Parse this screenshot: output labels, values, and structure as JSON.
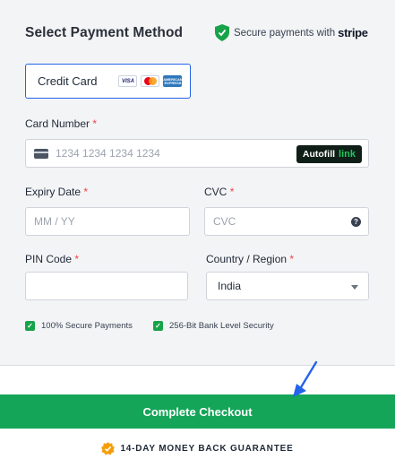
{
  "header": {
    "title": "Select Payment Method",
    "secure_text": "Secure payments with",
    "brand": "stripe"
  },
  "method": {
    "label": "Credit Card",
    "logos": [
      "VISA",
      "mastercard",
      "AMERICAN EXPRESS"
    ]
  },
  "card_number": {
    "label": "Card Number",
    "required_mark": "*",
    "placeholder": "1234 1234 1234 1234",
    "autofill_label": "Autofill",
    "autofill_link": "link"
  },
  "expiry": {
    "label": "Expiry Date",
    "required_mark": "*",
    "placeholder": "MM / YY"
  },
  "cvc": {
    "label": "CVC",
    "required_mark": "*",
    "placeholder": "CVC",
    "help_icon": "?"
  },
  "pin": {
    "label": "PIN Code",
    "required_mark": "*",
    "value": ""
  },
  "country": {
    "label": "Country / Region",
    "required_mark": "*",
    "selected": "India"
  },
  "badges": [
    {
      "label": "100% Secure Payments"
    },
    {
      "label": "256-Bit Bank Level Security"
    }
  ],
  "checkout": {
    "button_label": "Complete Checkout"
  },
  "guarantee": {
    "text": "14-DAY MONEY BACK GUARANTEE"
  },
  "colors": {
    "accent": "#14a558",
    "selected_border": "#2563eb",
    "required": "#ef4444",
    "arrow": "#2563eb"
  }
}
